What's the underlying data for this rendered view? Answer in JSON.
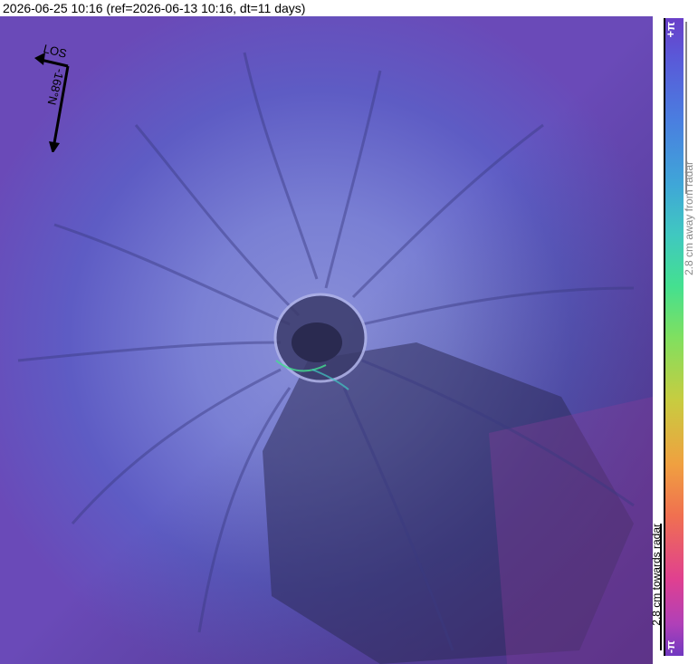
{
  "header": {
    "title": "2026-06-25 10:16 (ref=2026-06-13 10:16, dt=11 days)"
  },
  "compass": {
    "los_label": "LOS",
    "heading_label": "-168°N",
    "icon": "los-direction-arrow-icon"
  },
  "colorbar": {
    "top_label": "+π",
    "bottom_label": "-π",
    "away_label": "2.8 cm away from radar",
    "towards_label": "2.8 cm towards radar"
  },
  "colors": {
    "base_phase": "#5a62c8",
    "crater": "#3a3a6a"
  }
}
